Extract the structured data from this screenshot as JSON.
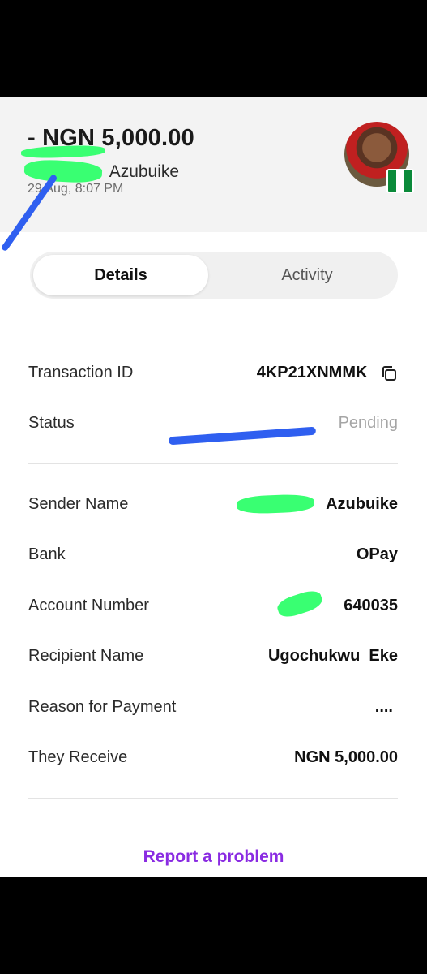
{
  "header": {
    "amount": "- NGN 5,000.00",
    "name_suffix": "Azubuike",
    "date": "29 Aug, 8:07 PM"
  },
  "tabs": [
    {
      "label": "Details",
      "active": true
    },
    {
      "label": "Activity",
      "active": false
    }
  ],
  "details": {
    "transaction_id_label": "Transaction ID",
    "transaction_id": "4KP21XNMMK",
    "status_label": "Status",
    "status": "Pending",
    "sender_name_label": "Sender Name",
    "sender_name": "Azubuike",
    "bank_label": "Bank",
    "bank": "OPay",
    "account_number_label": "Account Number",
    "account_number": "640035",
    "recipient_name_label": "Recipient Name",
    "recipient_name": "Ugochukwu  Eke",
    "reason_label": "Reason for Payment",
    "reason": "....",
    "they_receive_label": "They Receive",
    "they_receive": "NGN 5,000.00"
  },
  "footer": {
    "report_label": "Report a problem"
  },
  "colors": {
    "accent": "#8a2be2",
    "status_pending": "#a5a5a5",
    "flag_green": "#0b8a3a"
  },
  "icons": [
    "copy-icon",
    "nigeria-flag-icon",
    "user-avatar"
  ]
}
